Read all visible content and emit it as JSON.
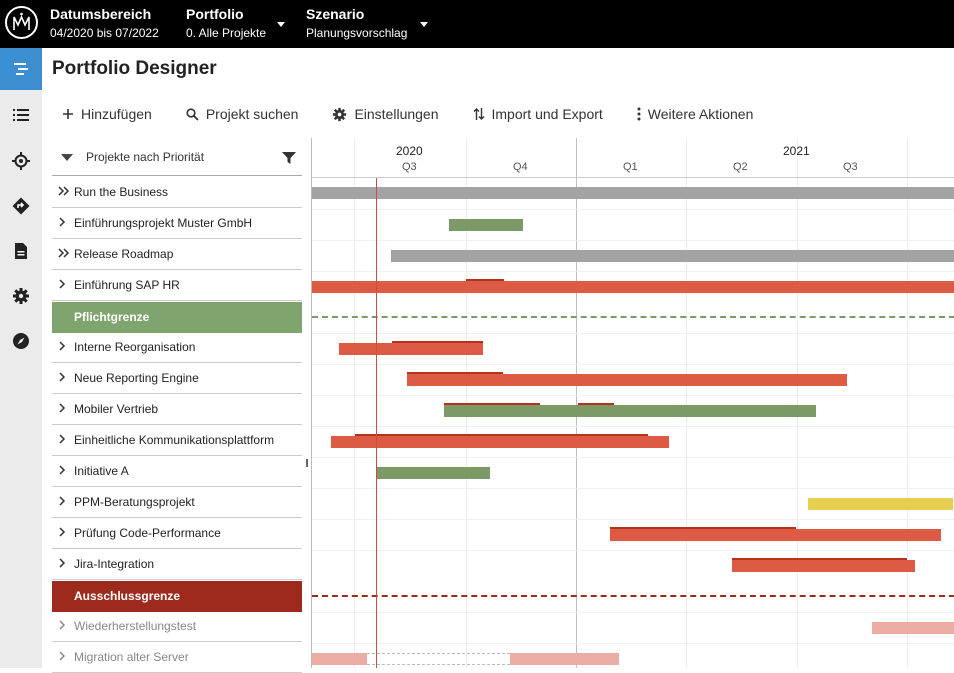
{
  "topbar": {
    "date_title": "Datumsbereich",
    "date_value": "04/2020 bis 07/2022",
    "portfolio_title": "Portfolio",
    "portfolio_value": "0. Alle Projekte",
    "scenario_title": "Szenario",
    "scenario_value": "Planungsvorschlag"
  },
  "page": {
    "title": "Portfolio Designer"
  },
  "toolbar": {
    "add": "Hinzufügen",
    "search": "Projekt suchen",
    "settings": "Einstellungen",
    "import_export": "Import und Export",
    "more": "Weitere Aktionen"
  },
  "list": {
    "header": "Projekte nach Priorität",
    "rows": [
      "Run the Business",
      "Einführungsprojekt Muster GmbH",
      "Release Roadmap",
      "Einführung SAP HR",
      "Pflichtgrenze",
      "Interne Reorganisation",
      "Neue Reporting Engine",
      "Mobiler Vertrieb",
      "Einheitliche Kommunikationsplattform",
      "Initiative A",
      "PPM-Beratungsprojekt",
      "Prüfung Code-Performance",
      "Jira-Integration",
      "Ausschlussgrenze",
      "Wiederherstellungstest",
      "Migration alter Server"
    ]
  },
  "timeline": {
    "years": [
      "2020",
      "2021"
    ],
    "quarters": [
      "Q3",
      "Q4",
      "Q1",
      "Q2",
      "Q3"
    ]
  },
  "colors": {
    "gray": "#a3a3a3",
    "green": "#7b9a68",
    "red": "#dd5a45",
    "red_dark": "#b5321f",
    "yellow": "#e6cf50",
    "pink": "#ebada3",
    "accent": "#3b8fd1"
  },
  "icons": {
    "rail": [
      "portfolio-designer-icon",
      "list-icon",
      "target-icon",
      "route-icon",
      "document-icon",
      "gear-icon",
      "compass-icon"
    ]
  }
}
